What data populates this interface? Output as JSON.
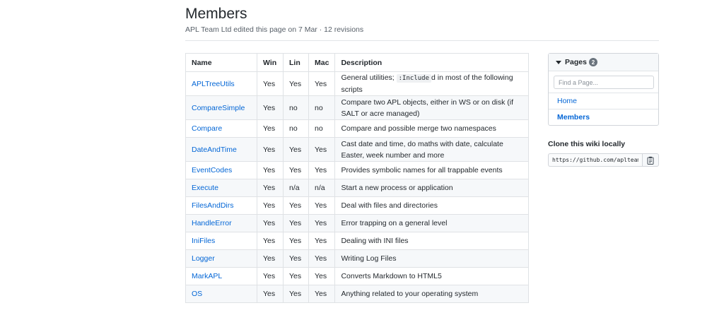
{
  "header": {
    "title": "Members",
    "meta": "APL Team Ltd edited this page on 7 Mar · 12 revisions"
  },
  "table": {
    "headers": [
      "Name",
      "Win",
      "Lin",
      "Mac",
      "Description"
    ],
    "rows": [
      {
        "name": "APLTreeUtils",
        "win": "Yes",
        "lin": "Yes",
        "mac": "Yes",
        "desc_pre": "General utilities; ",
        "desc_code": ":Include",
        "desc_post": "d in most of the following scripts"
      },
      {
        "name": "CompareSimple",
        "win": "Yes",
        "lin": "no",
        "mac": "no",
        "desc": "Compare two APL objects, either in WS or on disk (if SALT or acre managed)"
      },
      {
        "name": "Compare",
        "win": "Yes",
        "lin": "no",
        "mac": "no",
        "desc": "Compare and possible merge two namespaces"
      },
      {
        "name": "DateAndTime",
        "win": "Yes",
        "lin": "Yes",
        "mac": "Yes",
        "desc": "Cast date and time, do maths with date, calculate Easter, week number and more"
      },
      {
        "name": "EventCodes",
        "win": "Yes",
        "lin": "Yes",
        "mac": "Yes",
        "desc": "Provides symbolic names for all trappable events"
      },
      {
        "name": "Execute",
        "win": "Yes",
        "lin": "n/a",
        "mac": "n/a",
        "desc": "Start a new process or application"
      },
      {
        "name": "FilesAndDirs",
        "win": "Yes",
        "lin": "Yes",
        "mac": "Yes",
        "desc": "Deal with files and directories"
      },
      {
        "name": "HandleError",
        "win": "Yes",
        "lin": "Yes",
        "mac": "Yes",
        "desc": "Error trapping on a general level"
      },
      {
        "name": "IniFiles",
        "win": "Yes",
        "lin": "Yes",
        "mac": "Yes",
        "desc": "Dealing with INI files"
      },
      {
        "name": "Logger",
        "win": "Yes",
        "lin": "Yes",
        "mac": "Yes",
        "desc": "Writing Log Files"
      },
      {
        "name": "MarkAPL",
        "win": "Yes",
        "lin": "Yes",
        "mac": "Yes",
        "desc": "Converts Markdown to HTML5"
      },
      {
        "name": "OS",
        "win": "Yes",
        "lin": "Yes",
        "mac": "Yes",
        "desc": "Anything related to your operating system"
      }
    ]
  },
  "sidebar": {
    "pages_label": "Pages",
    "pages_count": "2",
    "search_placeholder": "Find a Page...",
    "items": [
      {
        "label": "Home"
      },
      {
        "label": "Members"
      }
    ],
    "clone_title": "Clone this wiki locally",
    "clone_url": "https://github.com/aplteam/"
  },
  "icons": {
    "pages_toggle": "caret-down-icon",
    "copy": "clipboard-icon"
  },
  "colors": {
    "link": "#0366d6",
    "text": "#24292e",
    "muted": "#586069",
    "border": "#dfe2e5",
    "stripe": "#f6f8fa"
  }
}
